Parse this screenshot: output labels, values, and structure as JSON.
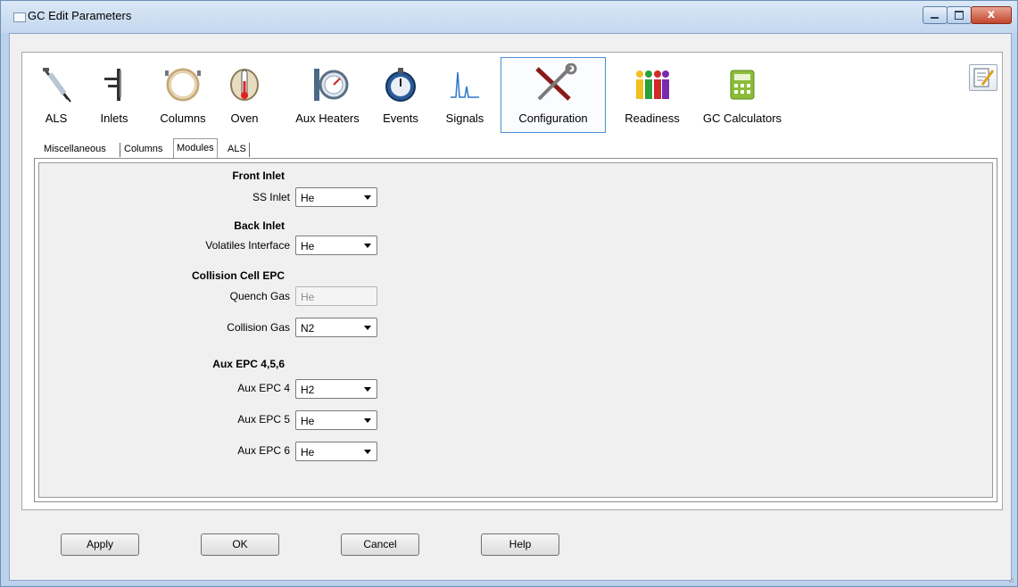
{
  "window": {
    "title": "GC Edit Parameters",
    "close_glyph": "x"
  },
  "toolbar": {
    "items": [
      {
        "label": "ALS",
        "icon": "syringe-icon"
      },
      {
        "label": "Inlets",
        "icon": "inlet-icon"
      },
      {
        "label": "Columns",
        "icon": "column-coil-icon"
      },
      {
        "label": "Oven",
        "icon": "oven-icon"
      },
      {
        "label": "Aux Heaters",
        "icon": "gauge-icon"
      },
      {
        "label": "Events",
        "icon": "stopwatch-icon"
      },
      {
        "label": "Signals",
        "icon": "signal-peaks-icon"
      },
      {
        "label": "Configuration",
        "icon": "tools-icon",
        "selected": true
      },
      {
        "label": "Readiness",
        "icon": "readiness-people-icon"
      },
      {
        "label": "GC Calculators",
        "icon": "calculator-icon"
      }
    ]
  },
  "tabs": [
    {
      "label": "Miscellaneous"
    },
    {
      "label": "Columns"
    },
    {
      "label": "Modules",
      "active": true
    },
    {
      "label": "ALS"
    }
  ],
  "modules": {
    "front_inlet": {
      "heading": "Front Inlet",
      "field_label": "SS Inlet",
      "value": "He"
    },
    "back_inlet": {
      "heading": "Back Inlet",
      "field_label": "Volatiles Interface",
      "value": "He"
    },
    "collision_cell": {
      "heading": "Collision Cell EPC",
      "quench_label": "Quench Gas",
      "quench_value": "He",
      "collision_label": "Collision Gas",
      "collision_value": "N2"
    },
    "aux_epc": {
      "heading": "Aux EPC 4,5,6",
      "epc4_label": "Aux EPC 4",
      "epc4_value": "H2",
      "epc5_label": "Aux EPC 5",
      "epc5_value": "He",
      "epc6_label": "Aux EPC 6",
      "epc6_value": "He"
    }
  },
  "buttons": {
    "apply": "Apply",
    "ok": "OK",
    "cancel": "Cancel",
    "help": "Help"
  }
}
